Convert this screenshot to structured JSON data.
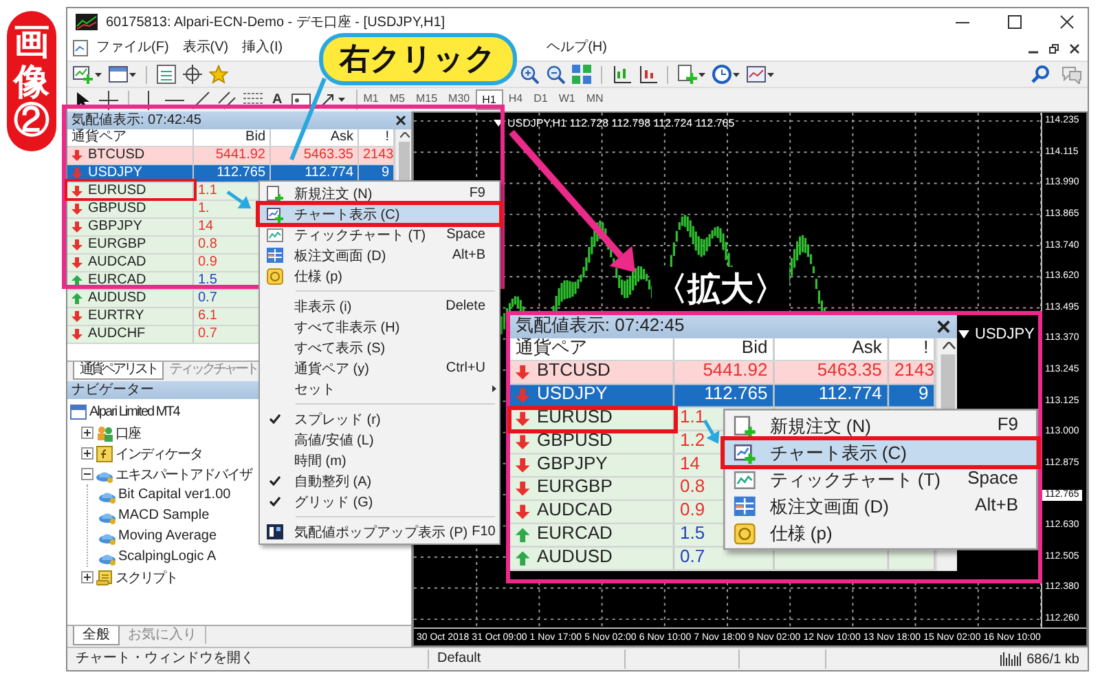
{
  "badge": {
    "text": "画像②"
  },
  "window": {
    "title": "60175813: Alpari-ECN-Demo - デモ口座 - [USDJPY,H1]"
  },
  "menu_bar": [
    {
      "label": "ファイル(F)"
    },
    {
      "label": "表示(V)"
    },
    {
      "label": "挿入(I)"
    },
    {
      "label": "ヘルプ(H)"
    }
  ],
  "toolbar": {
    "text_tool": "A",
    "timeframes": [
      {
        "label": "M1",
        "selected": false
      },
      {
        "label": "M5",
        "selected": false
      },
      {
        "label": "M15",
        "selected": false
      },
      {
        "label": "M30",
        "selected": false
      },
      {
        "label": "H1",
        "selected": true
      },
      {
        "label": "H4",
        "selected": false
      },
      {
        "label": "D1",
        "selected": false
      },
      {
        "label": "W1",
        "selected": false
      },
      {
        "label": "MN",
        "selected": false
      }
    ]
  },
  "market_watch": {
    "title": "気配値表示: 07:42:45",
    "columns": [
      "通貨ペア",
      "Bid",
      "Ask",
      "!"
    ],
    "rows": [
      {
        "symbol": "BTCUSD",
        "kind": "full",
        "rising": false,
        "bid": "5441.92",
        "ask": "5463.35",
        "spread": "2143",
        "selected": false,
        "highlighted": true
      },
      {
        "symbol": "USDJPY",
        "kind": "full",
        "rising": false,
        "bid": "112.765",
        "ask": "112.774",
        "spread": "9",
        "selected": true,
        "highlighted": false
      },
      {
        "symbol": "EURUSD",
        "kind": "partial",
        "rising": false,
        "bid": "1.1",
        "selected": false,
        "highlighted": false
      },
      {
        "symbol": "GBPUSD",
        "kind": "partial",
        "rising": false,
        "bid": "1.",
        "selected": false,
        "highlighted": false
      },
      {
        "symbol": "GBPJPY",
        "kind": "partial",
        "rising": false,
        "bid": "14",
        "selected": false,
        "highlighted": false
      },
      {
        "symbol": "EURGBP",
        "kind": "partial",
        "rising": false,
        "bid": "0.8",
        "selected": false,
        "highlighted": false
      },
      {
        "symbol": "AUDCAD",
        "kind": "partial",
        "rising": false,
        "bid": "0.9",
        "selected": false,
        "highlighted": false
      },
      {
        "symbol": "EURCAD",
        "kind": "partial",
        "rising": true,
        "bid": "1.5",
        "selected": false,
        "highlighted": false
      },
      {
        "symbol": "AUDUSD",
        "kind": "partial",
        "rising": true,
        "bid": "0.7",
        "selected": false,
        "highlighted": false
      },
      {
        "symbol": "EURTRY",
        "kind": "partial",
        "rising": false,
        "bid": "6.1",
        "selected": false,
        "highlighted": false
      },
      {
        "symbol": "AUDCHF",
        "kind": "partial",
        "rising": false,
        "bid": "0.7",
        "selected": false,
        "highlighted": false
      }
    ]
  },
  "market_watch_tabs": [
    {
      "label": "通貨ペアリスト",
      "selected": true
    },
    {
      "label": "ティックチャート",
      "selected": false
    }
  ],
  "navigator": {
    "title": "ナビゲーター",
    "tree": [
      {
        "label": "Alpari Limited MT4",
        "kind": "root",
        "children": [
          {
            "label": "口座",
            "kind": "accounts",
            "expanded": false
          },
          {
            "label": "インディケータ",
            "kind": "indicators",
            "expanded": false
          },
          {
            "label": "エキスパートアドバイザ",
            "kind": "experts",
            "expanded": true,
            "children": [
              {
                "label": "Bit Capital ver1.00",
                "kind": "expert"
              },
              {
                "label": "MACD Sample",
                "kind": "expert"
              },
              {
                "label": "Moving Average",
                "kind": "expert"
              },
              {
                "label": "ScalpingLogic A",
                "kind": "expert"
              }
            ]
          },
          {
            "label": "スクリプト",
            "kind": "scripts",
            "expanded": false
          }
        ]
      }
    ],
    "tabs": [
      {
        "label": "全般",
        "selected": true
      },
      {
        "label": "お気に入り",
        "selected": false
      }
    ]
  },
  "chart": {
    "header": "USDJPY,H1 112.728 112.798 112.724 112.765",
    "price_labels": [
      {
        "text": "114.235",
        "current": false
      },
      {
        "text": "114.115",
        "current": false
      },
      {
        "text": "113.990",
        "current": false
      },
      {
        "text": "113.865",
        "current": false
      },
      {
        "text": "113.740",
        "current": false
      },
      {
        "text": "113.620",
        "current": false
      },
      {
        "text": "113.495",
        "current": false
      },
      {
        "text": "113.370",
        "current": false
      },
      {
        "text": "113.245",
        "current": false
      },
      {
        "text": "113.125",
        "current": false
      },
      {
        "text": "113.000",
        "current": false
      },
      {
        "text": "112.875",
        "current": false
      },
      {
        "text": "112.765",
        "current": true
      },
      {
        "text": "112.630",
        "current": false
      },
      {
        "text": "112.505",
        "current": false
      },
      {
        "text": "112.380",
        "current": false
      },
      {
        "text": "112.260",
        "current": false
      }
    ],
    "time_labels": [
      "30 Oct 2018",
      "31 Oct 09:00",
      "1 Nov 17:00",
      "5 Nov 02:00",
      "6 Nov 10:00",
      "7 Nov 18:00",
      "9 Nov 02:00",
      "12 Nov 10:00",
      "13 Nov 18:00",
      "15 Nov 02:00",
      "16 Nov 10:00"
    ]
  },
  "context_menu": {
    "items": [
      {
        "kind": "item",
        "label": "新規注文 (N)",
        "shortcut": "F9",
        "highlighted": false
      },
      {
        "kind": "item",
        "label": "チャート表示 (C)",
        "highlighted": true
      },
      {
        "kind": "item",
        "label": "ティックチャート (T)",
        "shortcut": "Space",
        "highlighted": false
      },
      {
        "kind": "item",
        "label": "板注文画面 (D)",
        "shortcut": "Alt+B",
        "highlighted": false
      },
      {
        "kind": "item",
        "label": "仕様 (p)",
        "highlighted": false
      },
      {
        "kind": "separator"
      },
      {
        "kind": "item",
        "label": "非表示 (i)",
        "shortcut": "Delete",
        "highlighted": false
      },
      {
        "kind": "item",
        "label": "すべて非表示 (H)",
        "highlighted": false
      },
      {
        "kind": "item",
        "label": "すべて表示 (S)",
        "highlighted": false
      },
      {
        "kind": "item",
        "label": "通貨ペア (y)",
        "shortcut": "Ctrl+U",
        "highlighted": false
      },
      {
        "kind": "submenu",
        "label": "セット",
        "highlighted": false
      },
      {
        "kind": "separator"
      },
      {
        "kind": "check",
        "label": "スプレッド (r)",
        "checked": true,
        "highlighted": false
      },
      {
        "kind": "check",
        "label": "高値/安値 (L)",
        "checked": false,
        "highlighted": false
      },
      {
        "kind": "check",
        "label": "時間 (m)",
        "checked": false,
        "highlighted": false
      },
      {
        "kind": "check",
        "label": "自動整列 (A)",
        "checked": true,
        "highlighted": false
      },
      {
        "kind": "check",
        "label": "グリッド (G)",
        "checked": true,
        "highlighted": false
      },
      {
        "kind": "separator"
      },
      {
        "kind": "item",
        "label": "気配値ポップアップ表示 (P)",
        "shortcut": "F10",
        "highlighted": false
      }
    ]
  },
  "status_bar": {
    "hint": "チャート・ウィンドウを開く",
    "profile": "Default",
    "traffic": "686/1 kb"
  },
  "annotations": {
    "callout": "右クリック",
    "zoom_label": "〈拡大〉"
  },
  "zoom_inset": {
    "chart_label": "USDJPY",
    "market_watch": {
      "title": "気配値表示: 07:42:45",
      "columns": [
        "通貨ペア",
        "Bid",
        "Ask",
        "!"
      ],
      "rows": [
        {
          "symbol": "BTCUSD",
          "kind": "full",
          "rising": false,
          "bid": "5441.92",
          "ask": "5463.35",
          "spread": "2143",
          "selected": false,
          "highlighted": true
        },
        {
          "symbol": "USDJPY",
          "kind": "full",
          "rising": false,
          "bid": "112.765",
          "ask": "112.774",
          "spread": "9",
          "selected": true,
          "highlighted": false
        },
        {
          "symbol": "EURUSD",
          "kind": "partial",
          "rising": false,
          "bid": "1.1",
          "selected": false,
          "highlighted": false
        },
        {
          "symbol": "GBPUSD",
          "kind": "partial",
          "rising": false,
          "bid": "1.2",
          "selected": false,
          "highlighted": false
        },
        {
          "symbol": "GBPJPY",
          "kind": "partial",
          "rising": false,
          "bid": "14",
          "selected": false,
          "highlighted": false
        },
        {
          "symbol": "EURGBP",
          "kind": "partial",
          "rising": false,
          "bid": "0.8",
          "selected": false,
          "highlighted": false
        },
        {
          "symbol": "AUDCAD",
          "kind": "partial",
          "rising": false,
          "bid": "0.9",
          "selected": false,
          "highlighted": false
        },
        {
          "symbol": "EURCAD",
          "kind": "partial",
          "rising": true,
          "bid": "1.5",
          "selected": false,
          "highlighted": false
        },
        {
          "symbol": "AUDUSD",
          "kind": "partial",
          "rising": true,
          "bid": "0.7",
          "selected": false,
          "highlighted": false
        }
      ]
    },
    "context_menu": {
      "items": [
        {
          "kind": "item",
          "label": "新規注文 (N)",
          "shortcut": "F9",
          "highlighted": false
        },
        {
          "kind": "item",
          "label": "チャート表示 (C)",
          "highlighted": true
        },
        {
          "kind": "item",
          "label": "ティックチャート (T)",
          "shortcut": "Space",
          "highlighted": false
        },
        {
          "kind": "item",
          "label": "板注文画面 (D)",
          "shortcut": "Alt+B",
          "highlighted": false
        },
        {
          "kind": "item",
          "label": "仕様 (p)",
          "highlighted": false
        }
      ]
    }
  }
}
